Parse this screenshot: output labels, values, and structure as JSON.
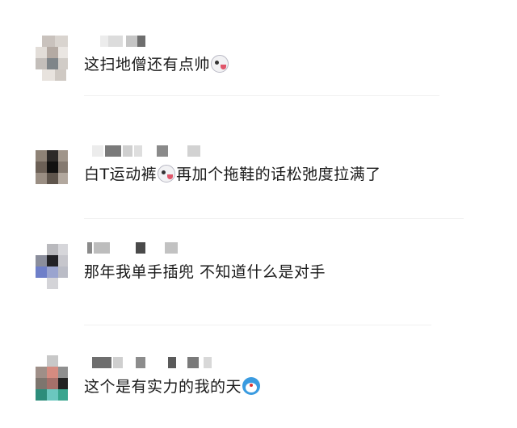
{
  "comments": [
    {
      "text_before": "这扫地僧还有点帅",
      "emoji": "laughing-tongue-emoji",
      "text_after": ""
    },
    {
      "text_before": "白T运动裤",
      "emoji": "laughing-tongue-emoji",
      "text_after": "再加个拖鞋的话松弛度拉满了"
    },
    {
      "text_before": "那年我单手插兜 不知道什么是对手",
      "emoji": "",
      "text_after": ""
    },
    {
      "text_before": "这个是有实力的我的天",
      "emoji": "doraemon-emoji",
      "text_after": ""
    }
  ],
  "colors": {
    "text": "#1a1a1a",
    "background": "#ffffff",
    "divider": "#f1f1f1"
  }
}
